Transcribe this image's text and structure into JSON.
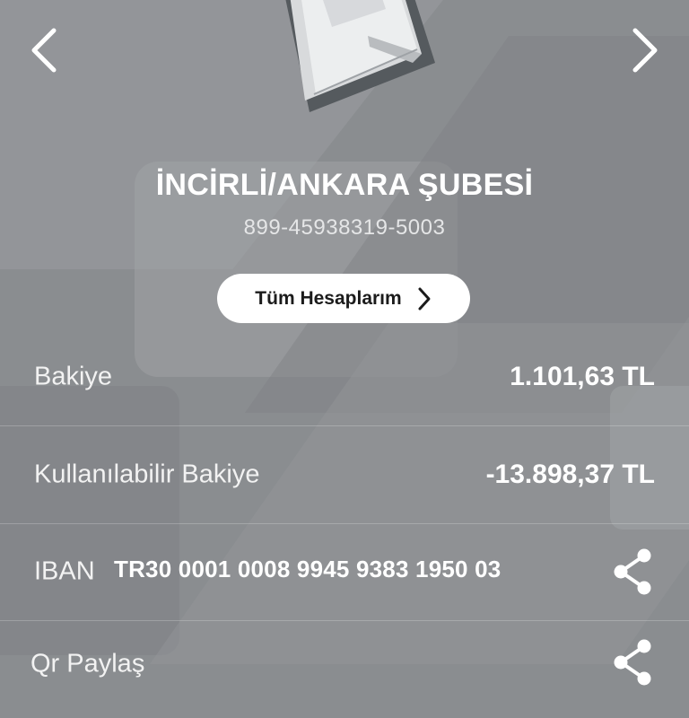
{
  "account": {
    "branch_name": "İNCİRLİ/ANKARA ŞUBESİ",
    "account_number": "899-45938319-5003"
  },
  "actions": {
    "all_accounts_label": "Tüm Hesaplarım"
  },
  "details": {
    "balance_label": "Bakiye",
    "balance_value": "1.101,63 TL",
    "available_label": "Kullanılabilir Bakiye",
    "available_value": "-13.898,37 TL",
    "iban_label": "IBAN",
    "iban_value": "TR30 0001 0008 9945 9383 1950 03",
    "qr_label": "Qr Paylaş"
  },
  "icons": {
    "prev": "chevron-left-icon",
    "next": "chevron-right-icon",
    "share": "share-icon"
  },
  "colors": {
    "background": "#8a8d90",
    "text": "#ffffff",
    "button_bg": "#ffffff",
    "button_text": "#1b1b1b"
  }
}
